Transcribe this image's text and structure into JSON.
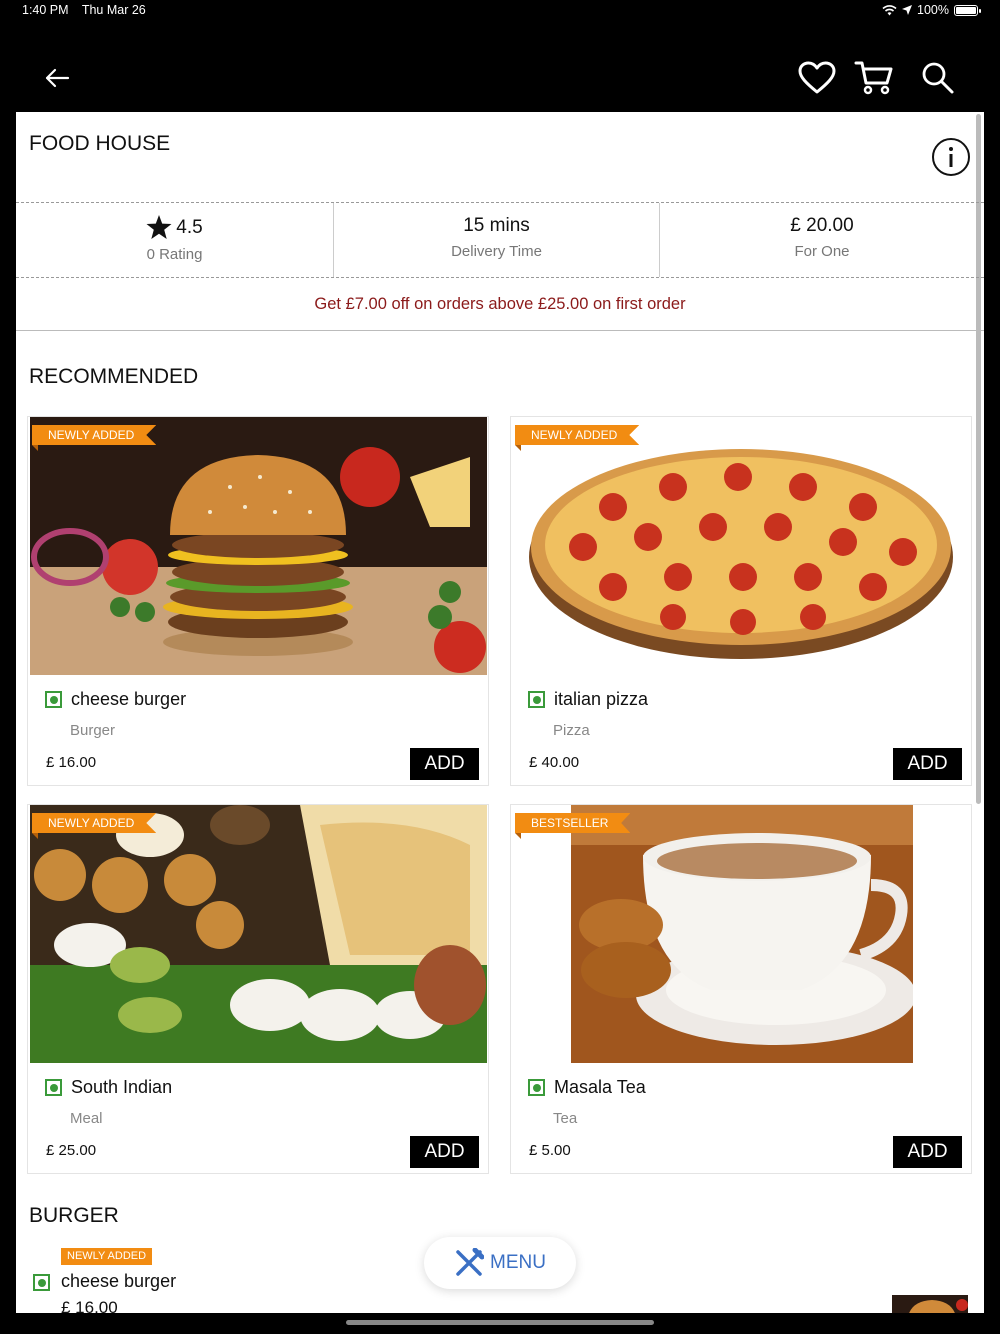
{
  "status_bar": {
    "time": "1:40 PM",
    "date": "Thu Mar 26",
    "battery": "100%"
  },
  "nav": {
    "back_icon": "arrow-left-icon",
    "wishlist_icon": "heart-icon",
    "cart_icon": "cart-icon",
    "search_icon": "search-icon"
  },
  "restaurant": {
    "name": "FOOD HOUSE",
    "rating": "4.5",
    "rating_label": "0 Rating",
    "delivery_time": "15 mins",
    "delivery_label": "Delivery Time",
    "cost": "£ 20.00",
    "cost_label": "For One",
    "offer": "Get £7.00 off on orders above £25.00  on first order"
  },
  "recommended": {
    "title": "RECOMMENDED",
    "items": [
      {
        "badge": "NEWLY ADDED",
        "name": "cheese burger",
        "category": "Burger",
        "price": "£ 16.00",
        "add_label": "ADD"
      },
      {
        "badge": "NEWLY ADDED",
        "name": "italian pizza",
        "category": "Pizza",
        "price": "£ 40.00",
        "add_label": "ADD"
      },
      {
        "badge": "NEWLY ADDED",
        "name": "South Indian",
        "category": "Meal",
        "price": "£ 25.00",
        "add_label": "ADD"
      },
      {
        "badge": "BESTSELLER",
        "name": "Masala Tea",
        "category": "Tea",
        "price": "£ 5.00",
        "add_label": "ADD"
      }
    ]
  },
  "burger_section": {
    "title": "BURGER",
    "items": [
      {
        "badge": "NEWLY ADDED",
        "name": "cheese burger",
        "price": "£ 16.00"
      }
    ]
  },
  "menu_button": {
    "label": "MENU"
  },
  "colors": {
    "offer_text": "#8b1a1a",
    "badge": "#f28c12",
    "veg": "#3a9a3a",
    "menu_accent": "#3a6fc4"
  }
}
